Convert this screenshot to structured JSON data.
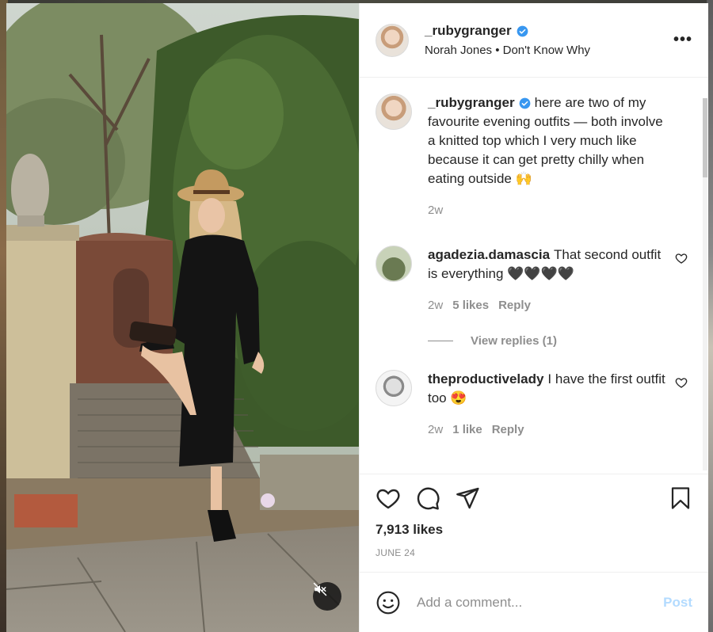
{
  "post": {
    "author": "_rubygranger",
    "verified": true,
    "audio": "Norah Jones • Don't Know Why",
    "caption": "here are two of my favourite evening outfits — both involve a knitted top which I very much like because it can get pretty chilly when eating outside 🙌",
    "caption_time": "2w",
    "likes": "7,913 likes",
    "date": "JUNE 24"
  },
  "comments": [
    {
      "user": "agadezia.damascia",
      "text": "That second outfit is everything 🖤🖤🖤🖤",
      "time": "2w",
      "likes": "5 likes",
      "reply": "Reply",
      "view_replies": "View replies (1)"
    },
    {
      "user": "theproductivelady",
      "text": "I have the first outfit too 😍",
      "time": "2w",
      "likes": "1 like",
      "reply": "Reply"
    }
  ],
  "composer": {
    "placeholder": "Add a comment...",
    "post_label": "Post"
  },
  "icons": {
    "more": "more-options-icon",
    "like": "heart-icon",
    "comment": "comment-icon",
    "share": "share-icon",
    "save": "bookmark-icon",
    "emoji": "emoji-icon",
    "mute": "muted-speaker-icon",
    "verified": "verified-badge-icon"
  },
  "colors": {
    "accent": "#0095f6",
    "post_disabled": "#b3dbff",
    "secondary_text": "#8e8e8e"
  }
}
